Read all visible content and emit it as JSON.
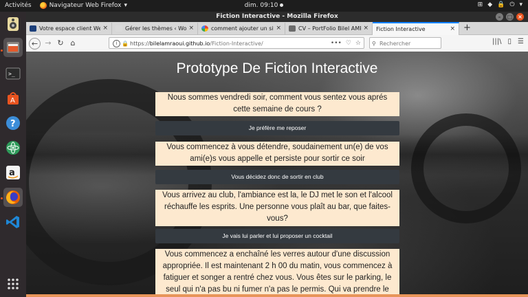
{
  "topbar": {
    "activities": "Activités",
    "app_name": "Navigateur Web Firefox",
    "app_caret": "▾",
    "clock": "dim. 09:10",
    "tray": [
      "⊞",
      "◆",
      "🔒",
      "⏻",
      "▾"
    ]
  },
  "window": {
    "title": "Fiction Interactive - Mozilla Firefox",
    "controls": [
      "–",
      "□",
      "×"
    ]
  },
  "tabs": [
    {
      "title": "Votre espace client Web",
      "close": "×"
    },
    {
      "title": "Gérer les thèmes ‹ WordPre",
      "close": "×"
    },
    {
      "title": "comment ajouter un site",
      "close": "×"
    },
    {
      "title": "CV – PortFolio Bilel AMR",
      "close": "×"
    },
    {
      "title": "Fiction Interactive",
      "close": "×"
    }
  ],
  "newtab": "+",
  "nav": {
    "back": "←",
    "forward": "→",
    "reload": "↻",
    "home": "⌂",
    "info": "i",
    "lock": "🔒",
    "url_scheme": "https://",
    "url_host": "bilelamraoui.github.io",
    "url_path": "/Fiction-Interactive/",
    "page_actions": [
      "•••",
      "♡",
      "☆"
    ],
    "search_icon": "⚲",
    "search_placeholder": "Rechercher",
    "toolbar_icons": [
      "|||\\",
      "▯",
      "☰"
    ]
  },
  "page": {
    "heading": "Prototype De Fiction Interactive",
    "story": [
      "Nous sommes vendredi soir, comment vous sentez vous aprés cette semaine de cours ?",
      "Vous commencez à vous détendre, soudainement un(e) de vos ami(e)s vous appelle et persiste pour sortir ce soir",
      "Vous arrivez au club, l'ambiance est la, le DJ met le son et l'alcool réchauffe les esprits. Une personne vous plaît au bar, que faites-vous?",
      "Vous commencez a enchaîné les verres autour d'une discussion appropriée. Il est maintenant 2 h 00 du matin, vous commencez à fatiguer et songer a rentré chez vous. Vous êtes sur le parking, le seul qui n'a pas bu ni fumer n'a pas le permis. Qui va prendre le"
    ],
    "choices": [
      "Je préfère me reposer",
      "Vous décidez donc de sortir en club",
      "Je vais lui parler et lui proposer un cocktail"
    ]
  },
  "colors": {
    "panel_bg": "#fde9cf",
    "choice_bg": "#343a40",
    "accent": "#e95420",
    "tab_highlight": "#0a84ff"
  }
}
